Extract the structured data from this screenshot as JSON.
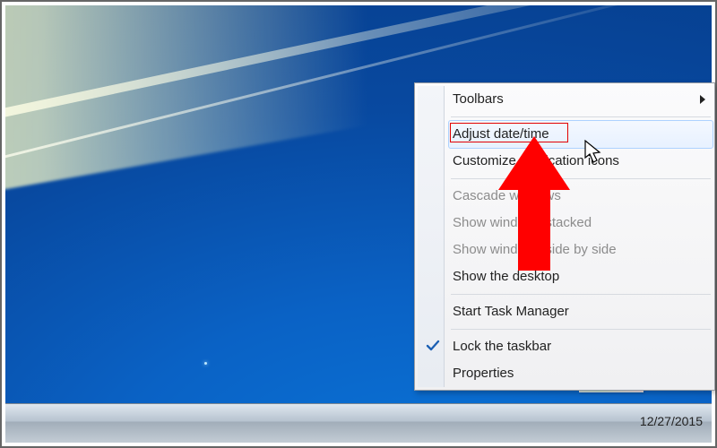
{
  "taskbar": {
    "date": "12/27/2015"
  },
  "context_menu": {
    "items": [
      {
        "id": "toolbars",
        "label": "Toolbars",
        "submenu": true
      },
      {
        "separator": true
      },
      {
        "id": "adjust-datetime",
        "label": "Adjust date/time",
        "highlighted": true,
        "red_outline": true
      },
      {
        "id": "customize-notification-icons",
        "label": "Customize notification icons"
      },
      {
        "separator": true
      },
      {
        "id": "cascade-windows",
        "label": "Cascade windows",
        "disabled": true
      },
      {
        "id": "show-windows-stacked",
        "label": "Show windows stacked",
        "disabled": true
      },
      {
        "id": "show-windows-sidebyside",
        "label": "Show windows side by side",
        "disabled": true
      },
      {
        "id": "show-the-desktop",
        "label": "Show the desktop"
      },
      {
        "separator": true
      },
      {
        "id": "start-task-manager",
        "label": "Start Task Manager"
      },
      {
        "separator": true
      },
      {
        "id": "lock-the-taskbar",
        "label": "Lock the taskbar",
        "checked": true
      },
      {
        "id": "properties",
        "label": "Properties"
      }
    ]
  },
  "colors": {
    "highlight_border": "#e20000",
    "arrow_fill": "#ff0000"
  }
}
